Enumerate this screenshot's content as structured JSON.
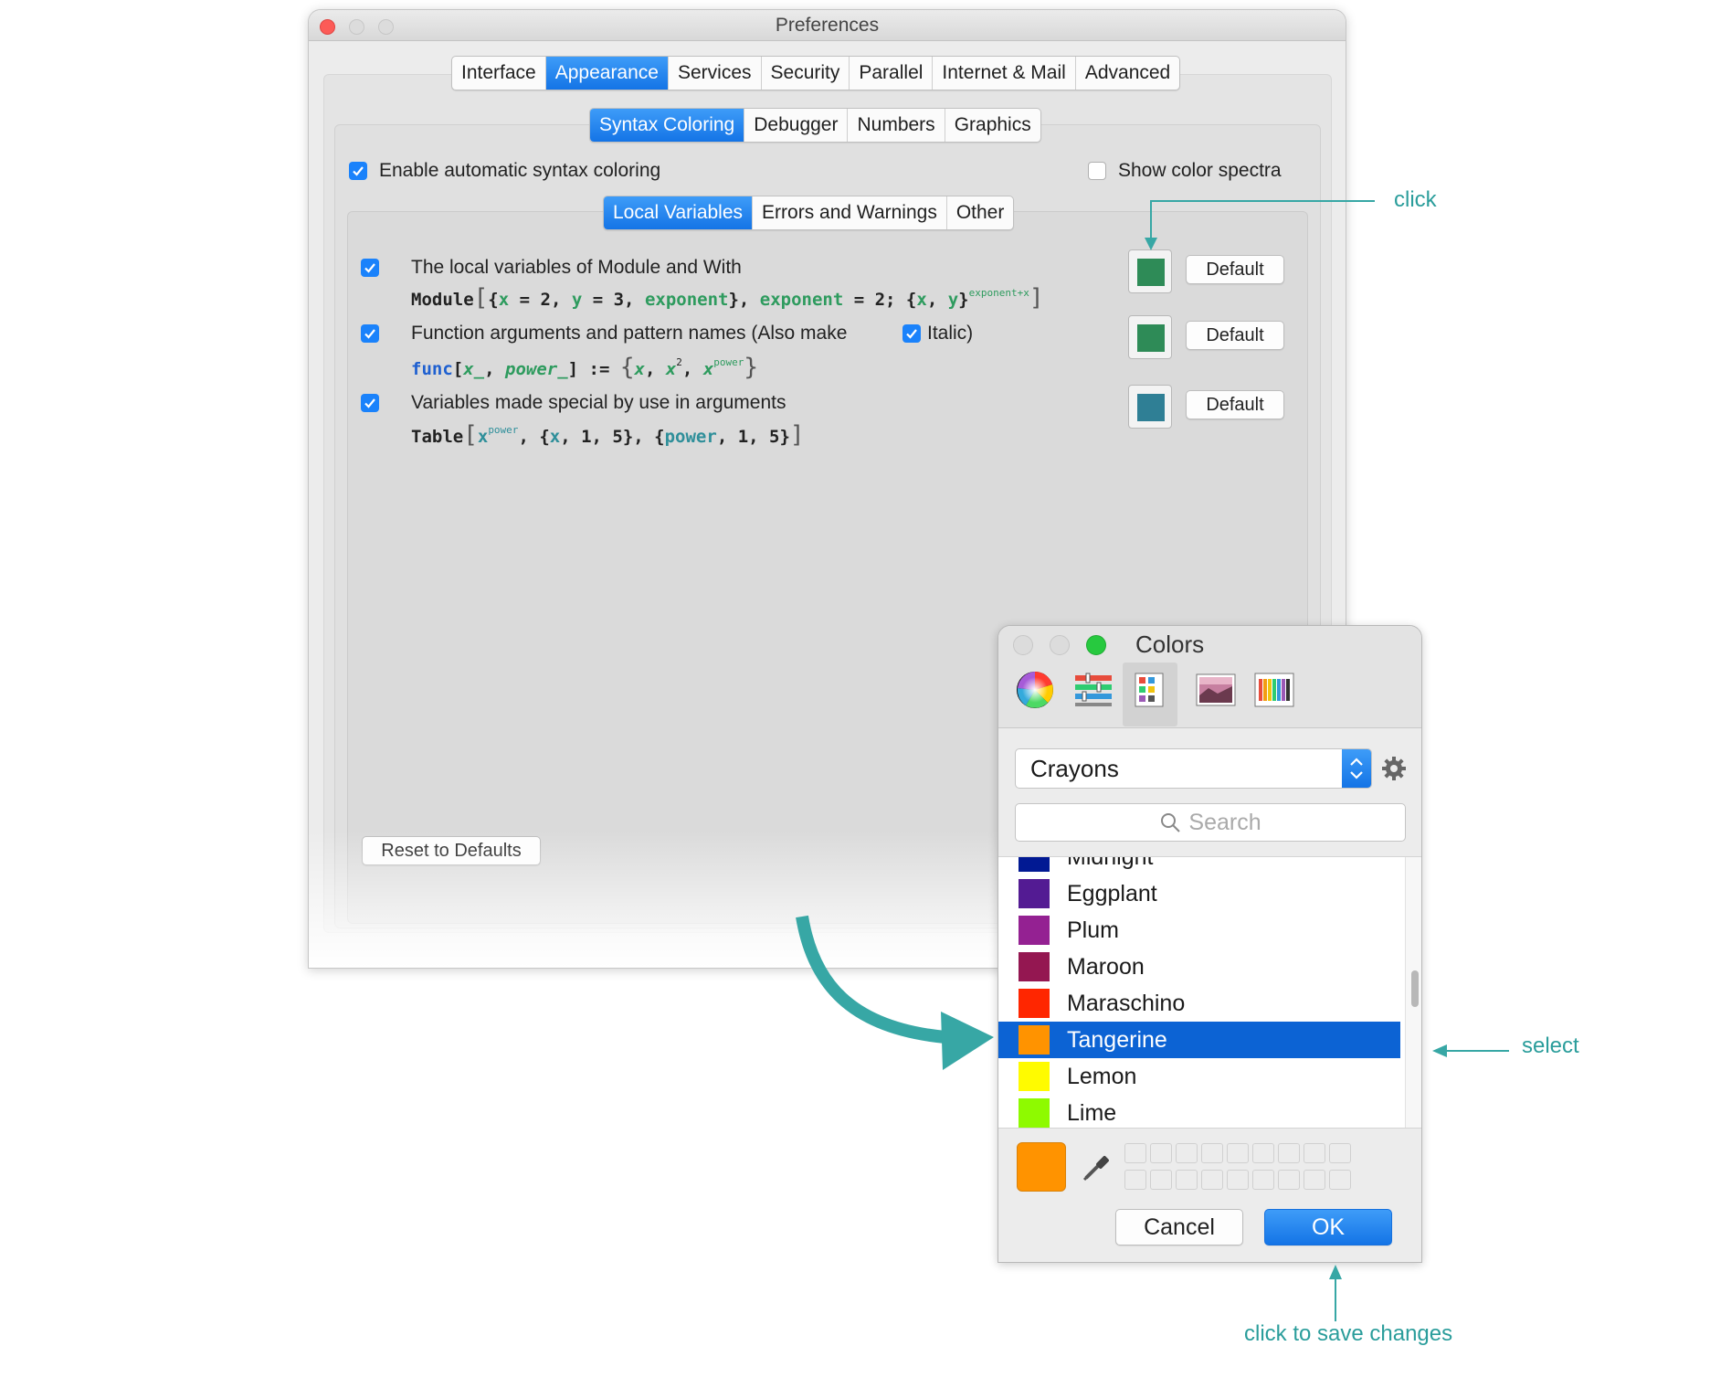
{
  "prefs_window": {
    "title": "Preferences",
    "main_tabs": [
      "Interface",
      "Appearance",
      "Services",
      "Security",
      "Parallel",
      "Internet & Mail",
      "Advanced"
    ],
    "main_tab_selected": "Appearance",
    "sub_tabs": [
      "Syntax Coloring",
      "Debugger",
      "Numbers",
      "Graphics"
    ],
    "sub_tab_selected": "Syntax Coloring",
    "enable_label": "Enable automatic syntax coloring",
    "enable_checked": true,
    "spectra_label": "Show color spectra",
    "spectra_checked": false,
    "category_tabs": [
      "Local Variables",
      "Errors and Warnings",
      "Other"
    ],
    "category_selected": "Local Variables",
    "rows": [
      {
        "label": "The local variables of Module and With",
        "checked": true,
        "color": "#2e8b57",
        "default_label": "Default"
      },
      {
        "label": "Function arguments and pattern names (Also make",
        "checked": true,
        "color": "#2e8b57",
        "default_label": "Default",
        "italic_label": "Italic)",
        "italic_checked": true
      },
      {
        "label": "Variables made special by use in arguments",
        "checked": true,
        "color": "#2f7f95",
        "default_label": "Default"
      }
    ],
    "reset_label": "Reset to Defaults"
  },
  "colors_panel": {
    "title": "Colors",
    "modes": [
      "color-wheel-icon",
      "sliders-icon",
      "palettes-icon",
      "image-palettes-icon",
      "pencils-icon"
    ],
    "palette": "Crayons",
    "search_placeholder": "Search",
    "items": [
      {
        "name": "Midnight",
        "color": "#011993"
      },
      {
        "name": "Eggplant",
        "color": "#531b93"
      },
      {
        "name": "Plum",
        "color": "#942192"
      },
      {
        "name": "Maroon",
        "color": "#941751"
      },
      {
        "name": "Maraschino",
        "color": "#ff2600"
      },
      {
        "name": "Tangerine",
        "color": "#ff9300"
      },
      {
        "name": "Lemon",
        "color": "#fffb00"
      },
      {
        "name": "Lime",
        "color": "#8efa00"
      }
    ],
    "selected_item": "Tangerine",
    "current_color": "#ff9300",
    "cancel_label": "Cancel",
    "ok_label": "OK"
  },
  "annotations": {
    "click": "click",
    "select": "select",
    "save": "click to save changes"
  }
}
